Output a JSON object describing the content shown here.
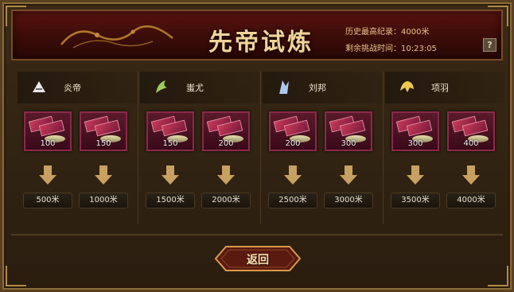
{
  "window": {
    "title": "先帝试炼",
    "record_label": "历史最高纪录：",
    "record_value": "4000米",
    "remaining_label": "剩余挑战时间：",
    "remaining_value": "10:23:05",
    "help_label": "?"
  },
  "stages": [
    {
      "hero": "炎帝",
      "icon": "white-hero-icon",
      "cards": [
        {
          "value": "100"
        },
        {
          "value": "150"
        }
      ],
      "distances": [
        "500米",
        "1000米"
      ]
    },
    {
      "hero": "蚩尤",
      "icon": "green-hero-icon",
      "cards": [
        {
          "value": "150"
        },
        {
          "value": "200"
        }
      ],
      "distances": [
        "1500米",
        "2000米"
      ]
    },
    {
      "hero": "刘邦",
      "icon": "blue-hero-icon",
      "cards": [
        {
          "value": "200"
        },
        {
          "value": "300"
        }
      ],
      "distances": [
        "2500米",
        "3000米"
      ]
    },
    {
      "hero": "项羽",
      "icon": "gold-hero-icon",
      "cards": [
        {
          "value": "300"
        },
        {
          "value": "400"
        }
      ],
      "distances": [
        "3500米",
        "4000米"
      ]
    }
  ],
  "footer": {
    "back_label": "返回"
  },
  "colors": {
    "banner": "#5a1410",
    "gold_text": "#f2d49a",
    "icon_white": "#e8e8e8",
    "icon_green": "#9acd5a",
    "icon_blue": "#aac8f0",
    "icon_gold": "#f0c850"
  }
}
